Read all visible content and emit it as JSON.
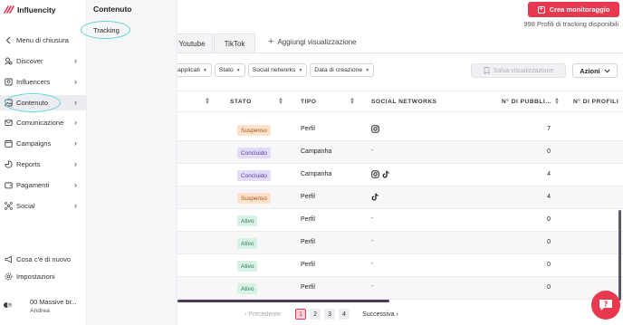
{
  "app": {
    "name": "Influencity"
  },
  "header": {
    "create_button": "Crea monitoraggio",
    "profiles_info": "998 Profili di tracking disponibili"
  },
  "tabs": [
    {
      "label": "Youtube"
    },
    {
      "label": "TikTok"
    }
  ],
  "add_view": "Aggiungi visualizzazione",
  "filters": [
    {
      "label": "applicati"
    },
    {
      "label": "Stato"
    },
    {
      "label": "Social networks"
    },
    {
      "label": "Data di creazione"
    }
  ],
  "save_view": "Salva visualizzazione",
  "actions": "Azioni",
  "table": {
    "columns": [
      "STATO",
      "TIPO",
      "SOCIAL NETWORKS",
      "N° DI PUBBLI...",
      "N° DI PROFILI"
    ],
    "rows": [
      {
        "stato": "Suspenso",
        "stato_kind": "suspeso",
        "tipo": "Perfil",
        "social": [
          "instagram"
        ],
        "social_text": "",
        "pubbl": "7"
      },
      {
        "stato": "Concluido",
        "stato_kind": "concluso",
        "tipo": "Campanha",
        "social": [],
        "social_text": "-",
        "pubbl": "0"
      },
      {
        "stato": "Concluido",
        "stato_kind": "concluso",
        "tipo": "Campanha",
        "social": [
          "instagram",
          "tiktok"
        ],
        "social_text": "",
        "pubbl": "4"
      },
      {
        "stato": "Suspenso",
        "stato_kind": "suspeso",
        "tipo": "Perfil",
        "social": [
          "tiktok"
        ],
        "social_text": "",
        "pubbl": "4"
      },
      {
        "stato": "Ativo",
        "stato_kind": "attivo",
        "tipo": "Perfil",
        "social": [],
        "social_text": "-",
        "pubbl": "0"
      },
      {
        "stato": "Ativo",
        "stato_kind": "attivo",
        "tipo": "Perfil",
        "social": [],
        "social_text": "-",
        "pubbl": "0"
      },
      {
        "stato": "Ativo",
        "stato_kind": "attivo",
        "tipo": "Perfil",
        "social": [],
        "social_text": "-",
        "pubbl": "0"
      },
      {
        "stato": "Ativo",
        "stato_kind": "attivo",
        "tipo": "Perfil",
        "social": [],
        "social_text": "-",
        "pubbl": "0"
      }
    ]
  },
  "pagination": {
    "prev": "Precedente",
    "next": "Successiva",
    "pages": [
      "1",
      "2",
      "3",
      "4"
    ],
    "current": "1"
  },
  "sidebar": {
    "collapse": "Menu di chiusura",
    "items": [
      {
        "label": "Discover",
        "icon": "discover-icon"
      },
      {
        "label": "Influencers",
        "icon": "influencers-icon"
      },
      {
        "label": "Contenuto",
        "icon": "content-icon"
      },
      {
        "label": "Comunicazione",
        "icon": "mail-icon"
      },
      {
        "label": "Campaigns",
        "icon": "calendar-icon"
      },
      {
        "label": "Reports",
        "icon": "reports-icon"
      },
      {
        "label": "Pagamenti",
        "icon": "wallet-icon"
      },
      {
        "label": "Social",
        "icon": "social-icon"
      }
    ],
    "whats_new": "Cosa c'è di nuovo",
    "settings": "Impostazioni",
    "user": {
      "name": "00 Massive br...",
      "sub": "Andrea"
    }
  },
  "submenu": {
    "title": "Contenuto",
    "item": "Tracking"
  },
  "colors": {
    "accent": "#e8384f",
    "highlight_ring": "#5ed6d0"
  }
}
